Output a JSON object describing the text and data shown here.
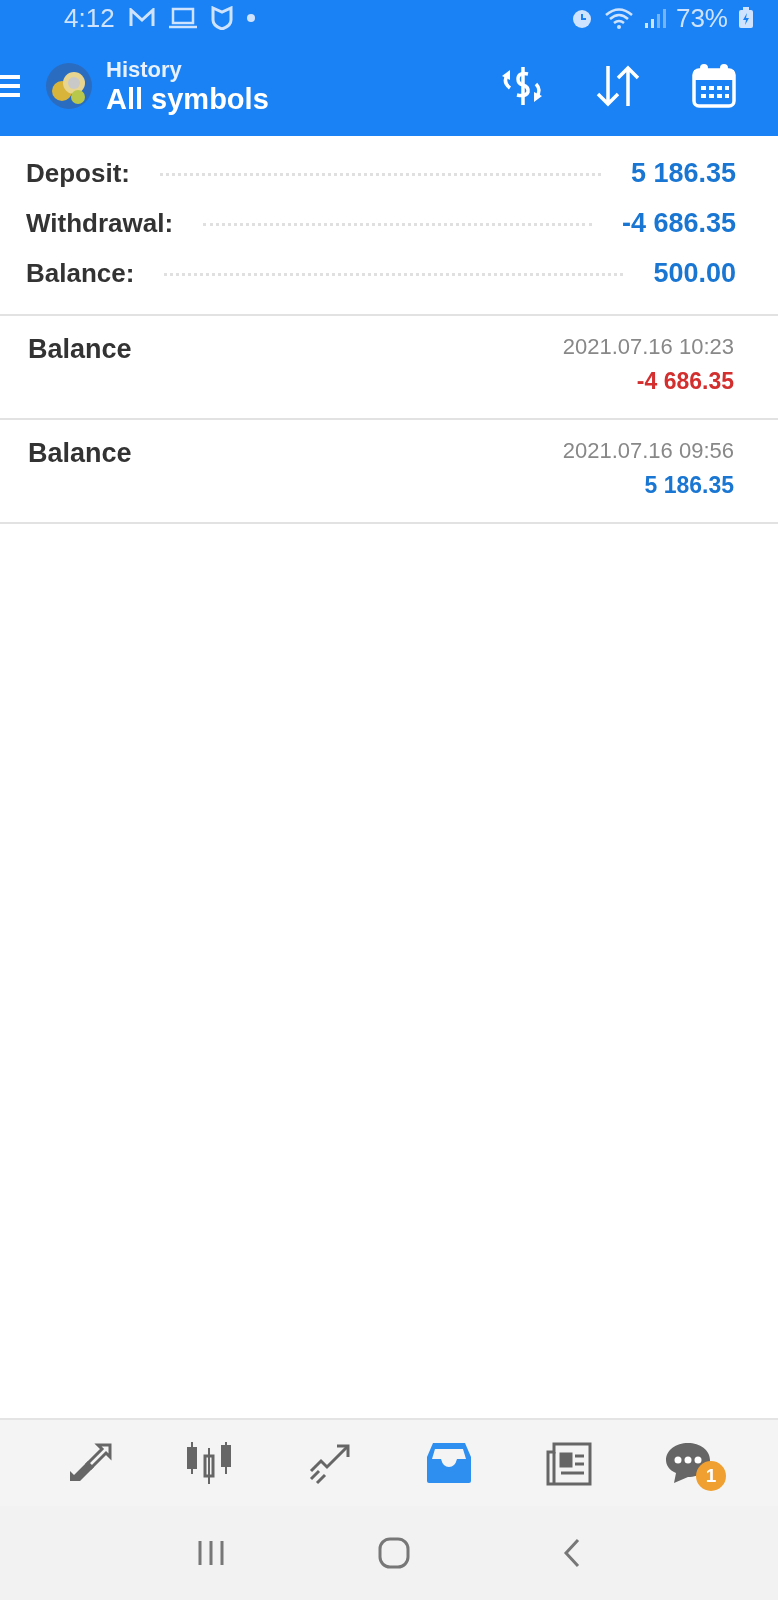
{
  "status_bar": {
    "time": "4:12",
    "battery": "73%"
  },
  "header": {
    "subtitle": "History",
    "title": "All symbols"
  },
  "summary": [
    {
      "label": "Deposit:",
      "value": "5 186.35"
    },
    {
      "label": "Withdrawal:",
      "value": "-4 686.35"
    },
    {
      "label": "Balance:",
      "value": "500.00"
    }
  ],
  "deals": [
    {
      "type": "Balance",
      "time": "2021.07.16 10:23",
      "amount": "-4 686.35",
      "color": "#d32f2f"
    },
    {
      "type": "Balance",
      "time": "2021.07.16 09:56",
      "amount": "5 186.35",
      "color": "#1976d2"
    }
  ],
  "bottom_nav": [
    {
      "kind": "trade",
      "selected": false
    },
    {
      "kind": "chart",
      "selected": false
    },
    {
      "kind": "trend",
      "selected": false
    },
    {
      "kind": "history",
      "selected": true
    },
    {
      "kind": "news",
      "selected": false
    },
    {
      "kind": "chat",
      "selected": false,
      "badge": "1"
    }
  ]
}
